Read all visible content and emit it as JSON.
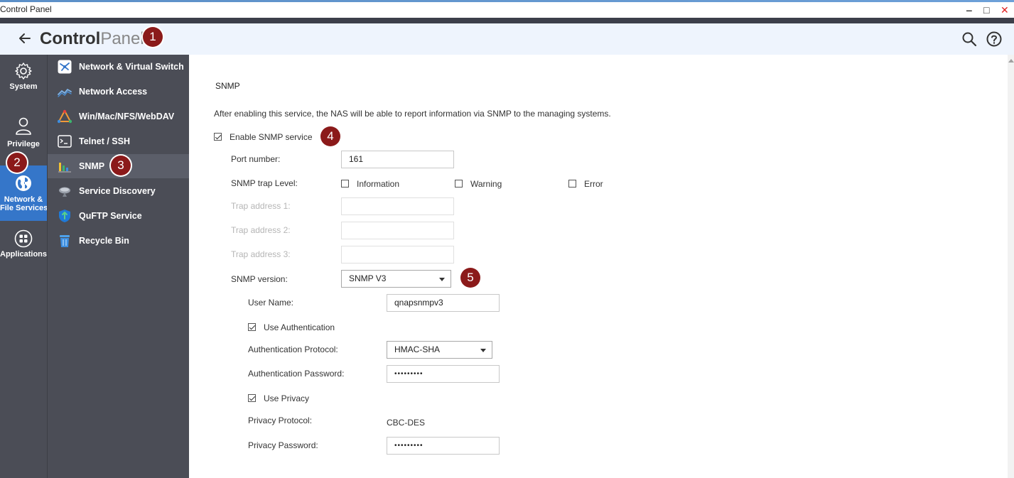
{
  "window": {
    "title": "Control Panel",
    "minimize": "‒",
    "maximize": "□",
    "close": "✕",
    "close_color": "#e02020"
  },
  "header": {
    "brand_bold": "Control",
    "brand_light": "Panel"
  },
  "badges": [
    "1",
    "2",
    "3",
    "4",
    "5"
  ],
  "rail": {
    "items": [
      {
        "label": "System"
      },
      {
        "label": "Privilege"
      },
      {
        "label_line1": "Network &",
        "label_line2": "File Services"
      },
      {
        "label": "Applications"
      }
    ],
    "active_color": "#3576c9"
  },
  "nav": {
    "items": [
      {
        "label": "Network & Virtual Switch"
      },
      {
        "label": "Network Access"
      },
      {
        "label": "Win/Mac/NFS/WebDAV"
      },
      {
        "label": "Telnet / SSH"
      },
      {
        "label": "SNMP"
      },
      {
        "label": "Service Discovery"
      },
      {
        "label": "QuFTP Service"
      },
      {
        "label": "Recycle Bin"
      }
    ]
  },
  "snmp": {
    "section_title": "SNMP",
    "description": "After enabling this service, the NAS will be able to report information via SNMP to the managing systems.",
    "enable_label": "Enable SNMP service",
    "enable_checked": true,
    "port_label": "Port number:",
    "port_value": "161",
    "trap_level_label": "SNMP trap Level:",
    "trap_levels": [
      {
        "label": "Information",
        "checked": false
      },
      {
        "label": "Warning",
        "checked": false
      },
      {
        "label": "Error",
        "checked": false
      }
    ],
    "trap_address_1_label": "Trap address 1:",
    "trap_address_2_label": "Trap address 2:",
    "trap_address_3_label": "Trap address 3:",
    "version_label": "SNMP version:",
    "version_value": "SNMP V3",
    "user_name_label": "User Name:",
    "user_name_value": "qnapsnmpv3",
    "use_auth_label": "Use Authentication",
    "use_auth_checked": true,
    "auth_protocol_label": "Authentication Protocol:",
    "auth_protocol_value": "HMAC-SHA",
    "auth_password_label": "Authentication Password:",
    "auth_password_value": "•••••••••",
    "use_privacy_label": "Use Privacy",
    "use_privacy_checked": true,
    "privacy_protocol_label": "Privacy Protocol:",
    "privacy_protocol_value": "CBC-DES",
    "privacy_password_label": "Privacy Password:",
    "privacy_password_value": "•••••••••"
  },
  "icons": {
    "back": "arrow-left-icon",
    "search": "search-icon",
    "help": "help-icon"
  }
}
